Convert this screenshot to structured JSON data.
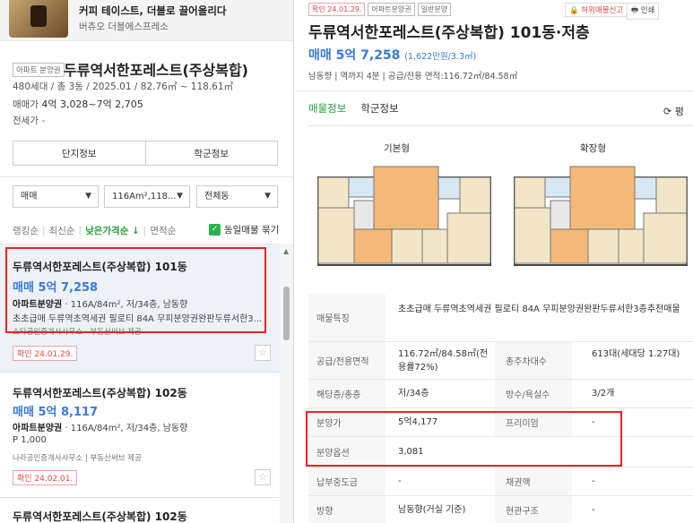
{
  "ad": {
    "title": "커피 테이스트, 더블로 끌어올리다",
    "sub": "버츄오 더블에스프레소"
  },
  "complex": {
    "tag": "아파트 분양권",
    "name": "두류역서한포레스트(주상복합)",
    "info": "480세대 / 총 3동 / 2025.01 / 82.76㎡ ~ 118.61㎡",
    "price_label": "매매가",
    "price_value": "4억 3,028~7억 2,705",
    "rent_label": "전세가 -",
    "btn_danji": "단지정보",
    "btn_school": "학군정보"
  },
  "filters": {
    "trade": "매매",
    "area": "116Am²,118...",
    "dong": "전체동"
  },
  "sort": {
    "items": [
      "랭킹순",
      "최신순",
      "낮은가격순 ↓",
      "면적순"
    ],
    "same_label": "동일매물 묶기"
  },
  "listings": [
    {
      "name": "두류역서한포레스트(주상복합) 101동",
      "price": "매매 5억 7,258",
      "spec_type": "아파트분양권",
      "spec": " · 116A/84m², 저/34층, 남동향",
      "desc": "초초급매 두류역초역세권 필로티 84A 무피분양권완판두류서한3...",
      "agent": "스타공인중개사사무소 · 부동산써브 제공",
      "confirm": "확인 24.01.29."
    },
    {
      "name": "두류역서한포레스트(주상복합) 102동",
      "price": "매매 5억 8,117",
      "spec_type": "아파트분양권",
      "spec": " · 116A/84m², 저/34층, 남동향",
      "desc": "P 1,000",
      "agent": "나라공인중개사사무소 | 부동산써브 제공",
      "confirm": "확인 24.02.01."
    },
    {
      "name": "두류역서한포레스트(주상복합) 102동"
    }
  ],
  "detail": {
    "tags": [
      "확인 24.01.29.",
      "아파트분양권",
      "일반분양"
    ],
    "report": "허위매물신고",
    "print": "인쇄",
    "title": "두류역서한포레스트(주상복합) 101동·저층",
    "price": "매매 5억 7,258",
    "price_sub": "(1,622만원/3.3㎡)",
    "info": "남동향 | 역까지 4분 | 공급/전용 면적:116.72㎡/84.58㎡",
    "tab_info": "매물정보",
    "tab_school": "학군정보",
    "refresh": "⟳ 평",
    "plan_basic": "기본형",
    "plan_ext": "확장형",
    "rows": [
      {
        "k": "매물특징",
        "v": "초초급매 두류역초역세권 필로티 84A 무피분양권완판두류서한3층추천매물"
      },
      {
        "k": "공급/전용면적",
        "v": "116.72㎡/84.58㎡(전용률72%)",
        "k2": "총주차대수",
        "v2": "613대(세대당 1.27대)"
      },
      {
        "k": "해당층/총층",
        "v": "저/34층",
        "k2": "방수/욕실수",
        "v2": "3/2개"
      },
      {
        "k": "분양가",
        "v": "5억4,177",
        "k2": "프리미엄",
        "v2": "-"
      },
      {
        "k": "분양옵션",
        "v": "3,081"
      },
      {
        "k": "납부중도금",
        "v": "-",
        "k2": "채권액",
        "v2": "-"
      },
      {
        "k": "방향",
        "v": "남동향(거실 기준)",
        "k2": "현관구조",
        "v2": "-"
      }
    ]
  },
  "colors": {
    "price_blue": "#3a79d9",
    "accent_green": "#2a9d3f",
    "highlight_red": "#e22"
  }
}
